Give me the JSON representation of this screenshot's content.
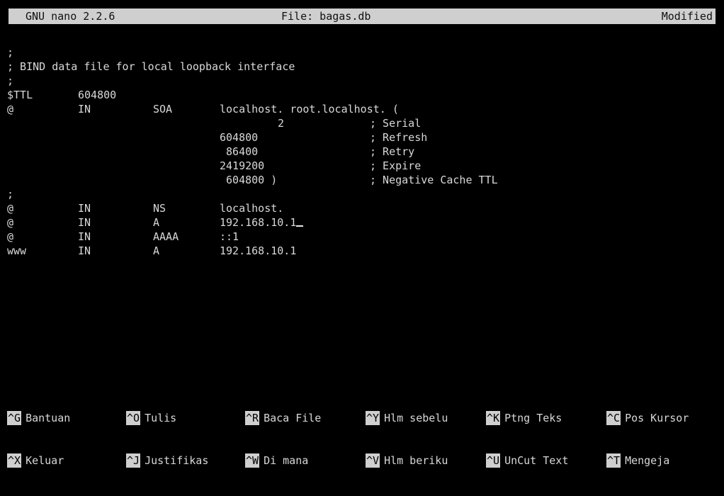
{
  "titlebar": {
    "app": "GNU nano 2.2.6",
    "file": "File: bagas.db",
    "status": "Modified"
  },
  "editor": {
    "lines": [
      {
        "c1": ";"
      },
      {
        "c1": "; BIND data file for local loopback interface"
      },
      {
        "c1": ";"
      },
      {
        "c1": "$TTL",
        "c2": "604800"
      },
      {
        "c1": "@",
        "c2": "IN",
        "c3": "SOA",
        "c4": "localhost. root.localhost. ("
      },
      {
        "c4b": "2",
        "c5": "; Serial"
      },
      {
        "c4": "604800",
        "c5": "; Refresh"
      },
      {
        "c4": " 86400",
        "c5": "; Retry"
      },
      {
        "c4": "2419200",
        "c5": "; Expire"
      },
      {
        "c4": " 604800 )",
        "c5": "; Negative Cache TTL"
      },
      {
        "c1": ";"
      },
      {
        "c1": "@",
        "c2": "IN",
        "c3": "NS",
        "c4": "localhost."
      },
      {
        "c1": "@",
        "c2": "IN",
        "c3": "A",
        "c4": "192.168.10.1",
        "cursor": true
      },
      {
        "c1": "@",
        "c2": "IN",
        "c3": "AAAA",
        "c4": "::1"
      },
      {
        "c1": "www",
        "c2": "IN",
        "c3": "A",
        "c4": "192.168.10.1"
      }
    ]
  },
  "shortcuts": {
    "row1": [
      {
        "key": "^G",
        "label": "Bantuan"
      },
      {
        "key": "^O",
        "label": "Tulis"
      },
      {
        "key": "^R",
        "label": "Baca File"
      },
      {
        "key": "^Y",
        "label": "Hlm sebelu"
      },
      {
        "key": "^K",
        "label": "Ptng Teks"
      },
      {
        "key": "^C",
        "label": "Pos Kursor"
      }
    ],
    "row2": [
      {
        "key": "^X",
        "label": "Keluar"
      },
      {
        "key": "^J",
        "label": "Justifikas"
      },
      {
        "key": "^W",
        "label": "Di mana"
      },
      {
        "key": "^V",
        "label": "Hlm beriku"
      },
      {
        "key": "^U",
        "label": "UnCut Text"
      },
      {
        "key": "^T",
        "label": "Mengeja"
      }
    ]
  }
}
